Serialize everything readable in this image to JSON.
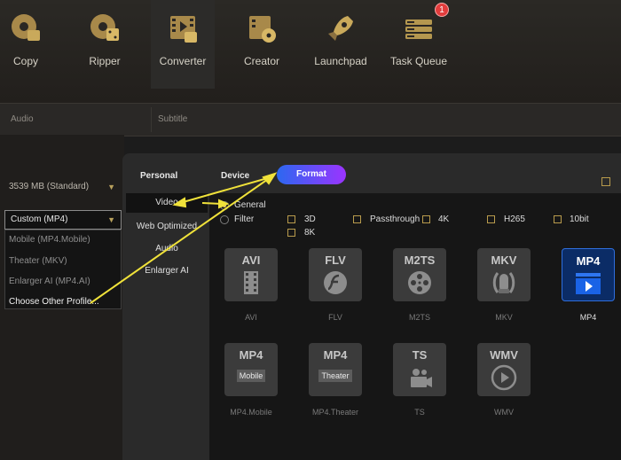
{
  "toolbar": {
    "items": [
      {
        "label": "Copy",
        "icon": "disc-copy-icon"
      },
      {
        "label": "Ripper",
        "icon": "disc-ripper-icon"
      },
      {
        "label": "Converter",
        "icon": "film-converter-icon"
      },
      {
        "label": "Creator",
        "icon": "disc-creator-icon"
      },
      {
        "label": "Launchpad",
        "icon": "rocket-icon"
      },
      {
        "label": "Task Queue",
        "icon": "task-queue-icon"
      }
    ],
    "active": "Converter",
    "task_badge": "1"
  },
  "subbar": {
    "audio_label": "Audio",
    "subtitle_label": "Subtitle"
  },
  "left_panel": {
    "size_value": "3539 MB (Standard)",
    "profile_value": "Custom (MP4)",
    "dropdown_items": [
      "Mobile (MP4.Mobile)",
      "Theater (MKV)",
      "Enlarger AI (MP4.AI)",
      "Choose Other Profile..."
    ]
  },
  "dialog": {
    "tabs": [
      "Personal",
      "Device",
      "Format"
    ],
    "active_tab": "Format",
    "side_items": [
      "Video",
      "Web Optimized",
      "Audio",
      "Enlarger AI"
    ],
    "active_side": "Video",
    "radios": [
      {
        "label": "General",
        "selected": true
      },
      {
        "label": "Filter",
        "selected": false
      }
    ],
    "filters": [
      "3D",
      "Passthrough",
      "4K",
      "H265",
      "10bit",
      "8K"
    ],
    "formats": [
      {
        "title": "AVI",
        "label": "AVI",
        "glyph": "film-strip-icon"
      },
      {
        "title": "FLV",
        "label": "FLV",
        "glyph": "flash-icon"
      },
      {
        "title": "M2TS",
        "label": "M2TS",
        "glyph": "film-reel-icon"
      },
      {
        "title": "MKV",
        "label": "MKV",
        "glyph": "matroska-icon"
      },
      {
        "title": "MP4",
        "label": "MP4",
        "glyph": "play-screen-icon"
      },
      {
        "title": "MP4",
        "label": "MP4.Mobile",
        "glyph": "mobile-badge",
        "sub": "Mobile"
      },
      {
        "title": "MP4",
        "label": "MP4.Theater",
        "glyph": "theater-badge",
        "sub": "Theater"
      },
      {
        "title": "TS",
        "label": "TS",
        "glyph": "camera-icon"
      },
      {
        "title": "WMV",
        "label": "WMV",
        "glyph": "play-circle-icon"
      }
    ],
    "selected_format": "MP4"
  },
  "colors": {
    "accent_gold": "#e1c16a",
    "format_gradient_start": "#2c68f0",
    "format_gradient_end": "#9b34ff",
    "arrow": "#f0e23a"
  }
}
